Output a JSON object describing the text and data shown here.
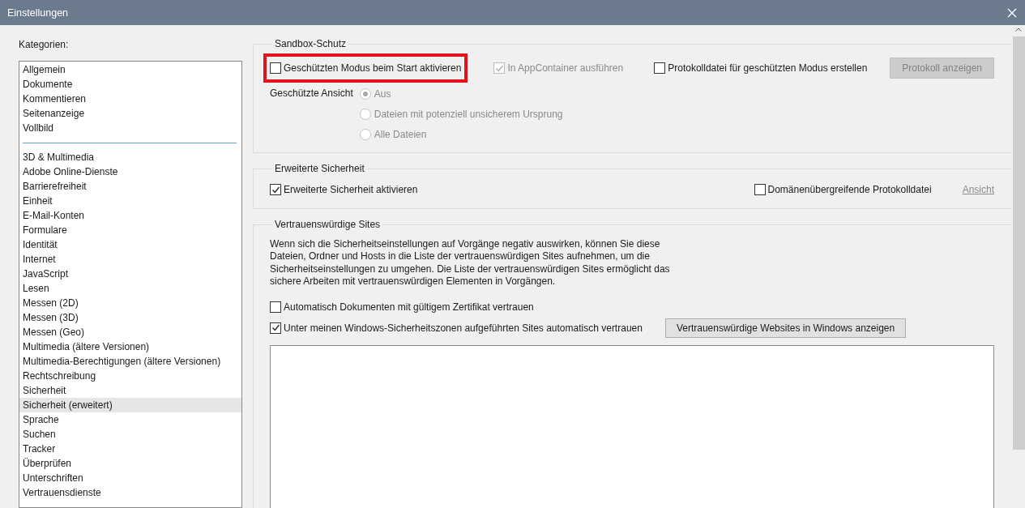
{
  "window": {
    "title": "Einstellungen"
  },
  "categories": {
    "label": "Kategorien:",
    "sections": [
      {
        "items": [
          {
            "label": "Allgemein",
            "selected": false
          },
          {
            "label": "Dokumente",
            "selected": false
          },
          {
            "label": "Kommentieren",
            "selected": false
          },
          {
            "label": "Seitenanzeige",
            "selected": false
          },
          {
            "label": "Vollbild",
            "selected": false
          }
        ]
      },
      {
        "items": [
          {
            "label": "3D & Multimedia",
            "selected": false
          },
          {
            "label": "Adobe Online-Dienste",
            "selected": false
          },
          {
            "label": "Barrierefreiheit",
            "selected": false
          },
          {
            "label": "Einheit",
            "selected": false
          },
          {
            "label": "E-Mail-Konten",
            "selected": false
          },
          {
            "label": "Formulare",
            "selected": false
          },
          {
            "label": "Identität",
            "selected": false
          },
          {
            "label": "Internet",
            "selected": false
          },
          {
            "label": "JavaScript",
            "selected": false
          },
          {
            "label": "Lesen",
            "selected": false
          },
          {
            "label": "Messen (2D)",
            "selected": false
          },
          {
            "label": "Messen (3D)",
            "selected": false
          },
          {
            "label": "Messen (Geo)",
            "selected": false
          },
          {
            "label": "Multimedia (ältere Versionen)",
            "selected": false
          },
          {
            "label": "Multimedia-Berechtigungen (ältere Versionen)",
            "selected": false
          },
          {
            "label": "Rechtschreibung",
            "selected": false
          },
          {
            "label": "Sicherheit",
            "selected": false
          },
          {
            "label": "Sicherheit (erweitert)",
            "selected": true
          },
          {
            "label": "Sprache",
            "selected": false
          },
          {
            "label": "Suchen",
            "selected": false
          },
          {
            "label": "Tracker",
            "selected": false
          },
          {
            "label": "Überprüfen",
            "selected": false
          },
          {
            "label": "Unterschriften",
            "selected": false
          },
          {
            "label": "Vertrauensdienste",
            "selected": false
          }
        ]
      }
    ]
  },
  "groups": [
    {
      "title": "Sandbox-Schutz",
      "rows": [
        {
          "controls": [
            {
              "kind": "checkbox",
              "label": "Geschützten Modus beim Start aktivieren",
              "checked": false,
              "disabled": false,
              "highlighted": true
            },
            {
              "kind": "checkbox",
              "label": "In AppContainer ausführen",
              "checked": true,
              "disabled": true,
              "highlighted": false
            },
            {
              "kind": "checkbox",
              "label": "Protokolldatei für geschützten Modus erstellen",
              "checked": false,
              "disabled": false,
              "highlighted": false
            },
            {
              "kind": "button",
              "label": "Protokoll anzeigen",
              "disabled": true
            }
          ]
        }
      ],
      "radio_group": {
        "label": "Geschützte Ansicht",
        "disabled": true,
        "options": [
          {
            "label": "Aus",
            "selected": true
          },
          {
            "label": "Dateien mit potenziell unsicherem Ursprung",
            "selected": false
          },
          {
            "label": "Alle Dateien",
            "selected": false
          }
        ]
      }
    },
    {
      "title": "Erweiterte Sicherheit",
      "rows": [
        {
          "controls": [
            {
              "kind": "checkbox",
              "label": "Erweiterte Sicherheit aktivieren",
              "checked": true,
              "disabled": false,
              "highlighted": false
            },
            {
              "kind": "checkbox",
              "label": "Domänenübergreifende Protokolldatei",
              "checked": false,
              "disabled": false,
              "highlighted": false
            },
            {
              "kind": "link",
              "label": "Ansicht",
              "disabled": true
            }
          ]
        }
      ]
    },
    {
      "title": "Vertrauenswürdige Sites",
      "description": "Wenn sich die Sicherheitseinstellungen auf Vorgänge negativ auswirken,  können Sie diese Dateien, Ordner und Hosts in die Liste der vertrauenswürdigen Sites aufnehmen, um die Sicherheitseinstellungen zu umgehen. Die Liste der vertrauenswürdigen Sites ermöglicht das sichere Arbeiten mit vertrauenswürdigen Elementen in Vorgängen.",
      "rows": [
        {
          "controls": [
            {
              "kind": "checkbox",
              "label": "Automatisch Dokumenten mit gültigem Zertifikat vertrauen",
              "checked": false,
              "disabled": false,
              "highlighted": false
            }
          ]
        },
        {
          "controls": [
            {
              "kind": "checkbox",
              "label": "Unter meinen Windows-Sicherheitszonen aufgeführten Sites automatisch vertrauen",
              "checked": true,
              "disabled": false,
              "highlighted": false
            },
            {
              "kind": "button",
              "label": "Vertrauenswürdige Websites in Windows anzeigen",
              "disabled": false
            }
          ]
        }
      ]
    }
  ]
}
